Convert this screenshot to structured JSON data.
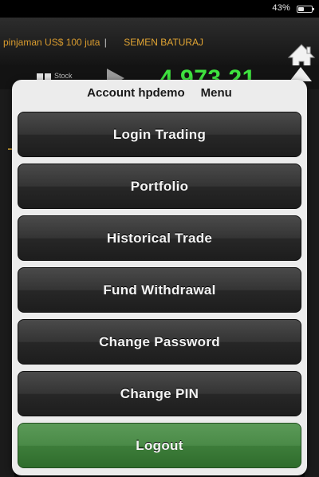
{
  "status_bar": {
    "battery_percent": "43%",
    "battery_level": 0.43
  },
  "ticker": {
    "items": [
      "pinjaman US$ 100 juta",
      "SEMEN BATURAJ"
    ],
    "separator": "|"
  },
  "index": {
    "label": "Stock",
    "value": "4,973.21"
  },
  "popover": {
    "account_label": "Account hpdemo",
    "menu_label": "Menu",
    "items": [
      {
        "label": "Login Trading"
      },
      {
        "label": "Portfolio"
      },
      {
        "label": "Historical Trade"
      },
      {
        "label": "Fund Withdrawal"
      },
      {
        "label": "Change Password"
      },
      {
        "label": "Change PIN"
      },
      {
        "label": "Logout"
      }
    ]
  },
  "colors": {
    "ticker_text": "#d99b2e",
    "index_value": "#3fe33f",
    "logout_button": "#4a8a47",
    "menu_button": "#343434"
  },
  "icons": {
    "home": "home-icon",
    "battery": "battery-icon"
  }
}
